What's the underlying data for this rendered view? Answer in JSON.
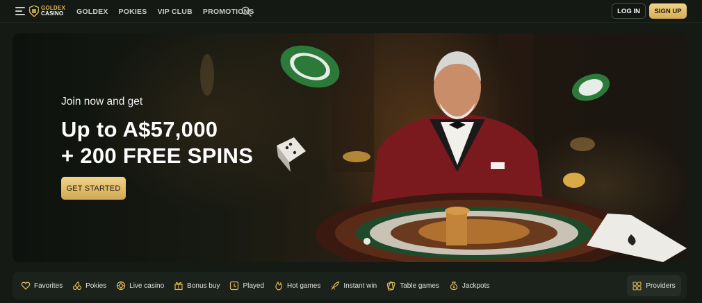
{
  "header": {
    "logo": {
      "line1": "GOLDEX",
      "line2": "CASINO",
      "icon": "shield-logo-icon"
    },
    "menu_icon": "hamburger-menu-icon",
    "nav": [
      {
        "label": "GOLDEX"
      },
      {
        "label": "POKIES"
      },
      {
        "label": "VIP CLUB"
      },
      {
        "label": "PROMOTIONS"
      }
    ],
    "search_icon": "search-icon",
    "login_label": "LOG IN",
    "signup_label": "SIGN UP"
  },
  "hero": {
    "pre": "Join now and get",
    "title_line1": "Up to A$57,000",
    "title_line2": "+ 200 FREE SPINS",
    "cta": "GET STARTED"
  },
  "categories": [
    {
      "label": "Favorites",
      "icon": "heart-icon"
    },
    {
      "label": "Pokies",
      "icon": "cherries-icon"
    },
    {
      "label": "Live casino",
      "icon": "roulette-chip-icon"
    },
    {
      "label": "Bonus buy",
      "icon": "gift-icon"
    },
    {
      "label": "Played",
      "icon": "clock-icon"
    },
    {
      "label": "Hot games",
      "icon": "flame-icon"
    },
    {
      "label": "Instant win",
      "icon": "rocket-icon"
    },
    {
      "label": "Table games",
      "icon": "cards-icon"
    },
    {
      "label": "Jackpots",
      "icon": "money-bag-icon"
    }
  ],
  "providers_label": "Providers",
  "colors": {
    "gold": "#e2b85a",
    "bg": "#151a15",
    "bar": "#1b211b"
  }
}
